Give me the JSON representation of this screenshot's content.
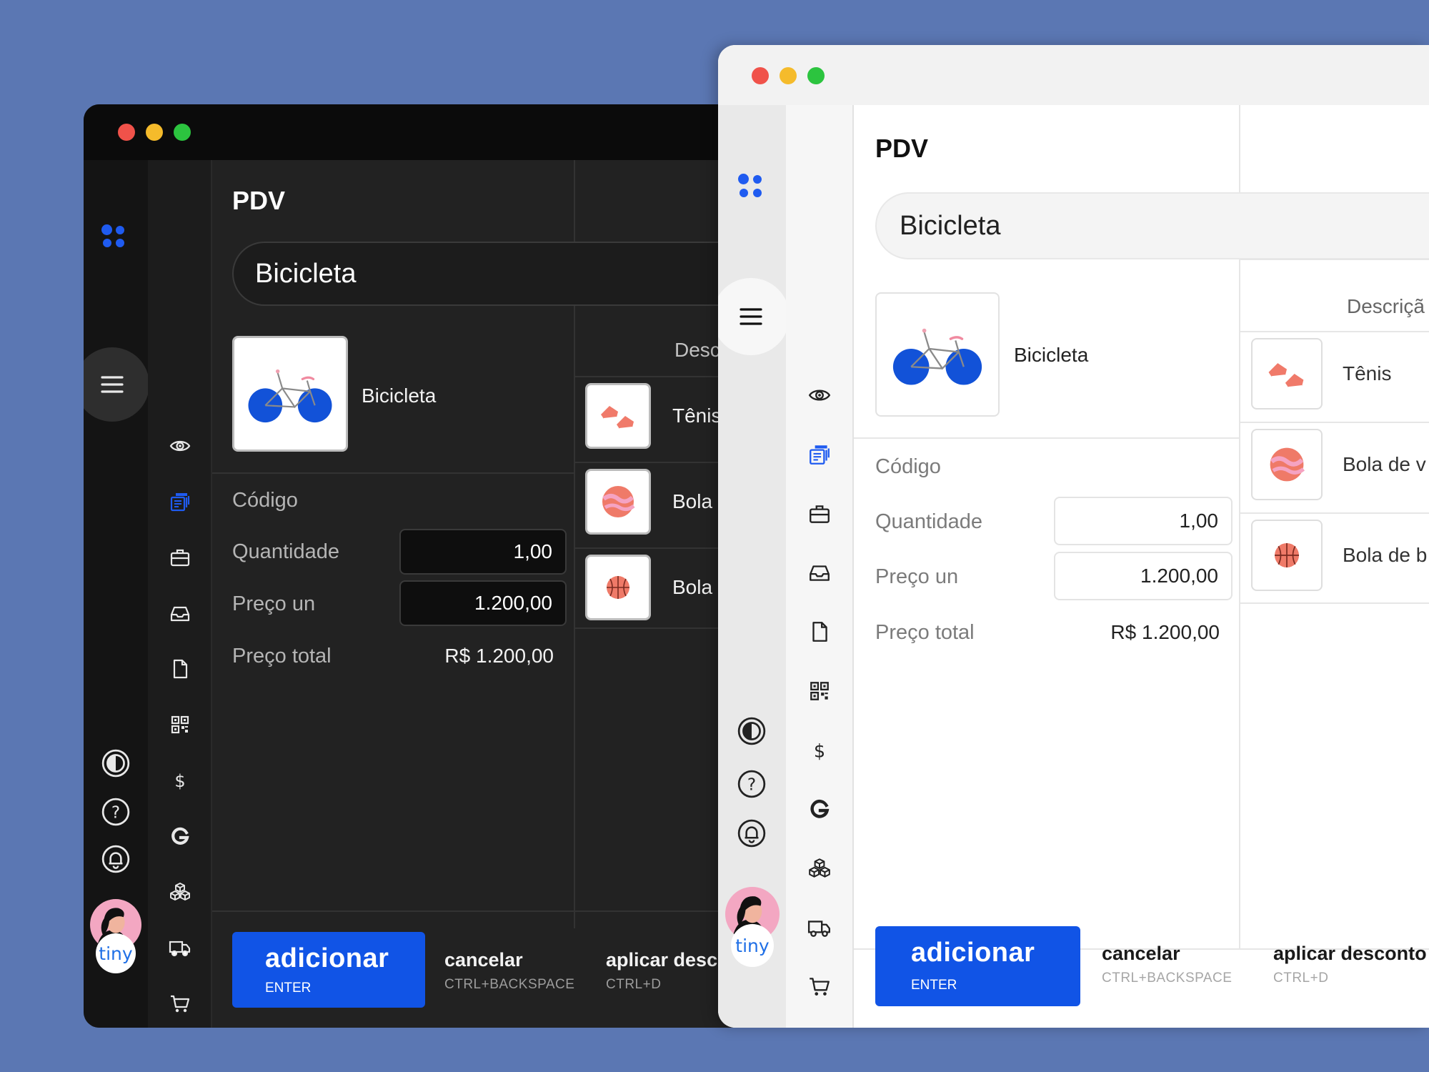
{
  "colors": {
    "background": "#5b77b3",
    "accent": "#1154e6",
    "close": "#f0524a",
    "minimize": "#f5bb2b",
    "maximize": "#2cc43f"
  },
  "app": {
    "title": "PDV",
    "badge": "tiny"
  },
  "sidebar_icons": [
    "eye-icon",
    "register-icon",
    "briefcase-icon",
    "inbox-icon",
    "document-icon",
    "qr-code-icon",
    "dollar-icon",
    "g-icon",
    "boxes-icon",
    "truck-icon",
    "cart-icon",
    "report-icon"
  ],
  "rail_icons": [
    "menu-icon",
    "contrast-icon",
    "help-icon",
    "bell-icon"
  ],
  "search": {
    "value": "Bicicleta"
  },
  "product": {
    "name": "Bicicleta"
  },
  "form": {
    "codigo_label": "Código",
    "quantidade_label": "Quantidade",
    "quantidade_value": "1,00",
    "preco_un_label": "Preço un",
    "preco_un_value": "1.200,00",
    "preco_total_label": "Preço total",
    "preco_total_value": "R$ 1.200,00"
  },
  "dark": {
    "desc_header": "Desc",
    "list": [
      "Tênis",
      "Bola",
      "Bola"
    ],
    "action_discount": "aplicar desc"
  },
  "light": {
    "desc_header": "Descriçã",
    "list": [
      "Tênis",
      "Bola de v",
      "Bola de b"
    ],
    "action_discount": "aplicar desconto"
  },
  "actions": {
    "add_label": "adicionar",
    "add_shortcut": "ENTER",
    "cancel_label": "cancelar",
    "cancel_shortcut": "CTRL+BACKSPACE",
    "discount_shortcut": "CTRL+D"
  }
}
